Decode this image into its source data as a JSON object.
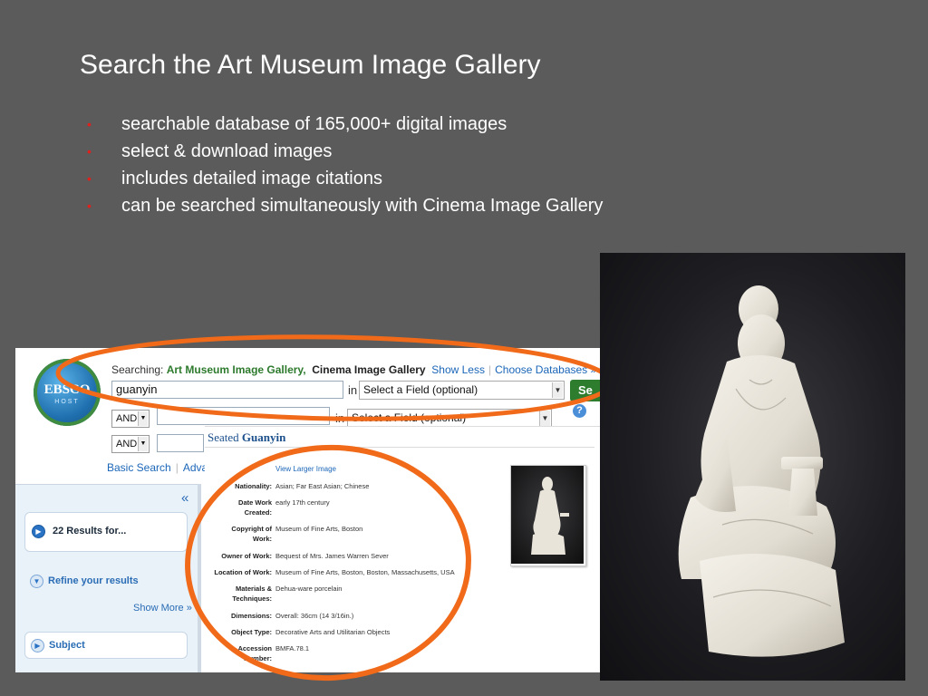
{
  "slide": {
    "title": "Search the Art Museum Image Gallery",
    "bullets": [
      "searchable database of 165,000+ digital images",
      "select & download images",
      "includes detailed image citations",
      "can be searched simultaneously with Cinema Image Gallery"
    ]
  },
  "ebsco": {
    "logo_text": "EBSCO",
    "logo_sub": "HOST",
    "searching_label": "Searching:",
    "db_primary": "Art Museum Image Gallery,",
    "db_secondary": "Cinema Image Gallery",
    "show_less": "Show Less",
    "choose_databases": "Choose Databases »",
    "query": "guanyin",
    "in_label": "in",
    "field_select_1": "Select a Field (optional)",
    "field_select_2": "Select a Field (optional)",
    "search_button": "Se",
    "operator_1": "AND",
    "operator_2": "AND",
    "basic_search": "Basic Search",
    "advanced_search": "Advan",
    "collapse_glyph": "«",
    "results": "22 Results for...",
    "refine": "Refine your results",
    "show_more": "Show More »",
    "subject": "Subject"
  },
  "record": {
    "title_prefix": "Seated",
    "title_main": "Guanyin",
    "view_larger": "View Larger Image",
    "fields": [
      {
        "label": "Nationality:",
        "value": "Asian; Far East Asian; Chinese"
      },
      {
        "label": "Date Work",
        "label2": "Created:",
        "value": "early 17th century"
      },
      {
        "label": "Copyright of",
        "label2": "Work:",
        "value": "Museum of Fine Arts, Boston"
      },
      {
        "label": "Owner of Work:",
        "value": "Bequest of Mrs. James Warren Sever"
      },
      {
        "label": "Location of Work:",
        "value": "Museum of Fine Arts, Boston, Boston, Massachusetts, USA"
      },
      {
        "label": "Materials &",
        "label2": "Techniques:",
        "value": "Dehua-ware porcelain"
      },
      {
        "label": "Dimensions:",
        "value": "Overall: 36cm (14 3/16in.)"
      },
      {
        "label": "Object Type:",
        "value": "Decorative Arts and Utilitarian Objects"
      },
      {
        "label": "Accession",
        "label2": "Number:",
        "value": "BMFA.78.1"
      }
    ]
  },
  "colors": {
    "slide_bg": "#5b5b5b",
    "bullet": "#e0201c",
    "annotation": "#f06a1a",
    "ebsco_green": "#2d7a2d",
    "link_blue": "#1b66b8"
  }
}
